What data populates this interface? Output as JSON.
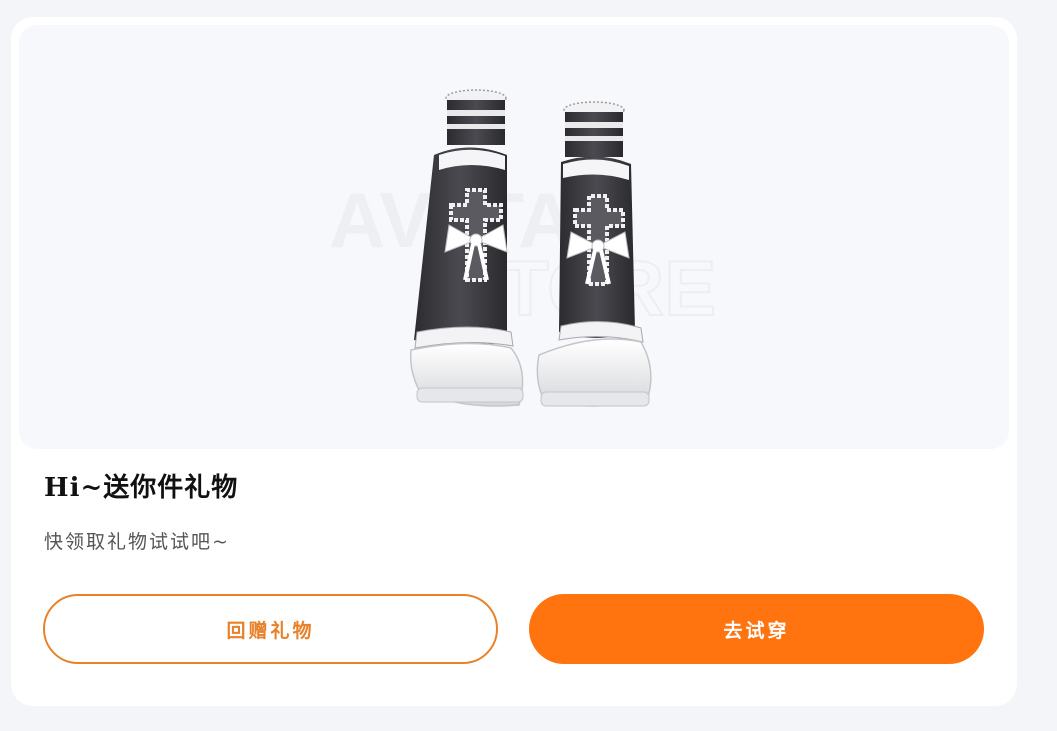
{
  "gift": {
    "image_alt": "gothic lolita platform boots",
    "watermark_lines": [
      "AVATAR",
      "STORE"
    ],
    "title": "Hi~送你件礼物",
    "subtitle": "快领取礼物试试吧~"
  },
  "actions": {
    "return_gift_label": "回赠礼物",
    "try_on_label": "去试穿"
  },
  "colors": {
    "accent": "#ff740f",
    "outline": "#e8822a",
    "background": "#f4f5f9"
  }
}
